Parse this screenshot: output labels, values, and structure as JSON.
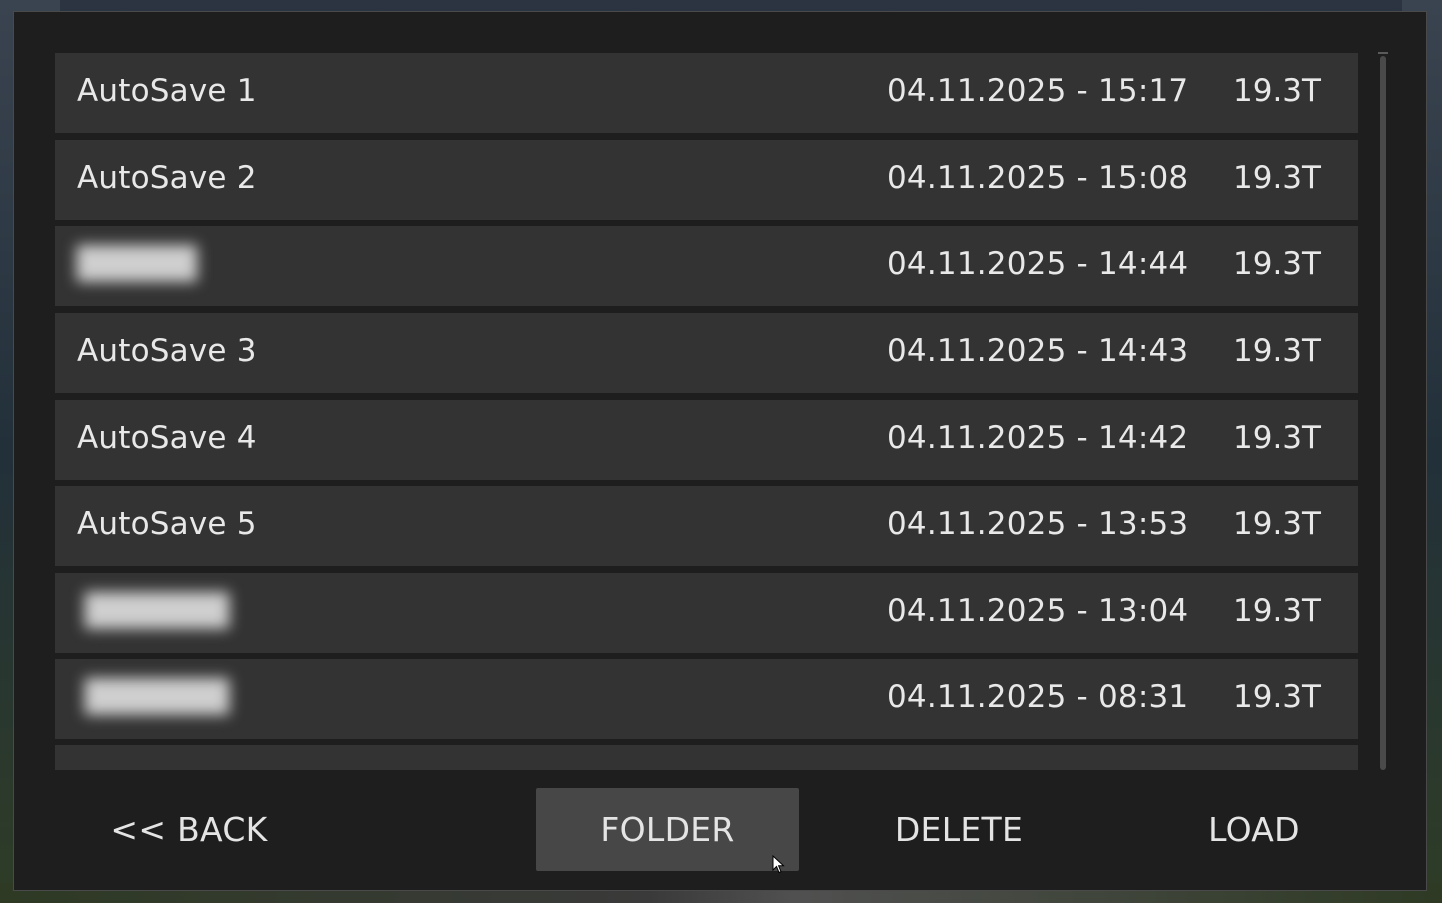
{
  "saves": [
    {
      "name": "AutoSave 1",
      "date": "04.11.2025 - 15:17",
      "size": "19.3T",
      "blurred": false
    },
    {
      "name": "AutoSave 2",
      "date": "04.11.2025 - 15:08",
      "size": "19.3T",
      "blurred": false
    },
    {
      "name": "",
      "date": "04.11.2025 - 14:44",
      "size": "19.3T",
      "blurred": true
    },
    {
      "name": "AutoSave 3",
      "date": "04.11.2025 - 14:43",
      "size": "19.3T",
      "blurred": false
    },
    {
      "name": "AutoSave 4",
      "date": "04.11.2025 - 14:42",
      "size": "19.3T",
      "blurred": false
    },
    {
      "name": "AutoSave 5",
      "date": "04.11.2025 - 13:53",
      "size": "19.3T",
      "blurred": false
    },
    {
      "name": "",
      "date": "04.11.2025 - 13:04",
      "size": "19.3T",
      "blurred": true
    },
    {
      "name": "",
      "date": "04.11.2025 - 08:31",
      "size": "19.3T",
      "blurred": true
    },
    {
      "name": "",
      "date": "",
      "size": "",
      "blurred": false
    }
  ],
  "buttons": {
    "back": "<< BACK",
    "folder": "FOLDER",
    "delete": "DELETE",
    "load": "LOAD"
  }
}
